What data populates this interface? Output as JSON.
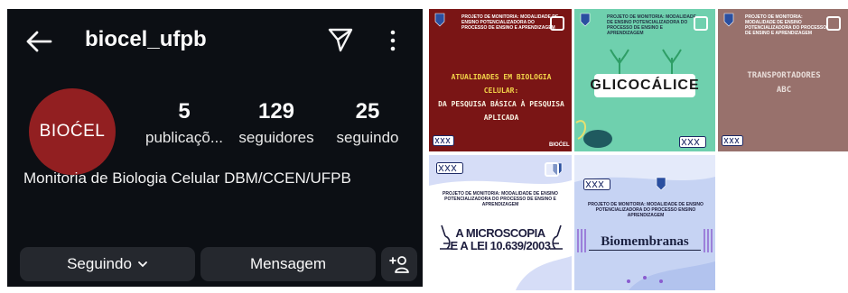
{
  "header": {
    "username": "biocel_ufpb",
    "back_icon": "arrow-left-icon",
    "send_icon": "paper-plane-icon",
    "more_icon": "vertical-dots-icon"
  },
  "profile": {
    "avatar_text": "BIOĆEL",
    "avatar_color": "#921f21",
    "posts_count": "5",
    "posts_label": "publicaçõ...",
    "followers_count": "129",
    "followers_label": "seguidores",
    "following_count": "25",
    "following_label": "seguindo",
    "bio": "Monitoria de Biologia Celular DBM/CCEN/UFPB"
  },
  "actions": {
    "following_label": "Seguindo",
    "message_label": "Mensagem",
    "add_user_icon": "add-person-icon"
  },
  "posts": [
    {
      "header": "PROJETO DE MONITORIA: MODALIDADE DE ENSINO POTENCIALIZADORA DO PROCESSO DE ENSINO E APRENDIZAGEM",
      "title_line1": "ATUALIDADES EM BIOLOGIA CELULAR:",
      "title_line2": "DA PESQUISA BÁSICA À PESQUISA",
      "title_line3": "APLICADA",
      "logo": "BIOĆEL",
      "color": "#7a1515"
    },
    {
      "header": "PROJETO DE MONITORIA: MODALIDADE DE ENSINO POTENCIALIZADORA DO PROCESSO DE ENSINO E APRENDIZAGEM",
      "title": "GLICOCÁLICE",
      "color": "#6fd0ae"
    },
    {
      "header": "PROJETO DE MONITORIA: MODALIDADE DE ENSINO POTENCIALIZADORA DO PROCESSO DE ENSINO E APRENDIZAGEM",
      "title_line1": "TRANSPORTADORES",
      "title_line2": "ABC",
      "color": "#98716c"
    },
    {
      "header": "PROJETO DE MONITORIA: MODALIDADE DE ENSINO POTENCIALIZADORA DO PROCESSO DE ENSINO E APRENDIZAGEM",
      "title_line1": "A MICROSCOPIA",
      "title_line2": "E A LEI 10.639/2003",
      "color": "#ffffff"
    },
    {
      "header": "PROJETO DE MONITORIA: MODALIDADE DE ENSINO POTENCIALIZADORA DO PROCESSO ENSINO APRENDIZAGEM",
      "title": "Biomembranas",
      "color": "#c6d3f3"
    }
  ]
}
